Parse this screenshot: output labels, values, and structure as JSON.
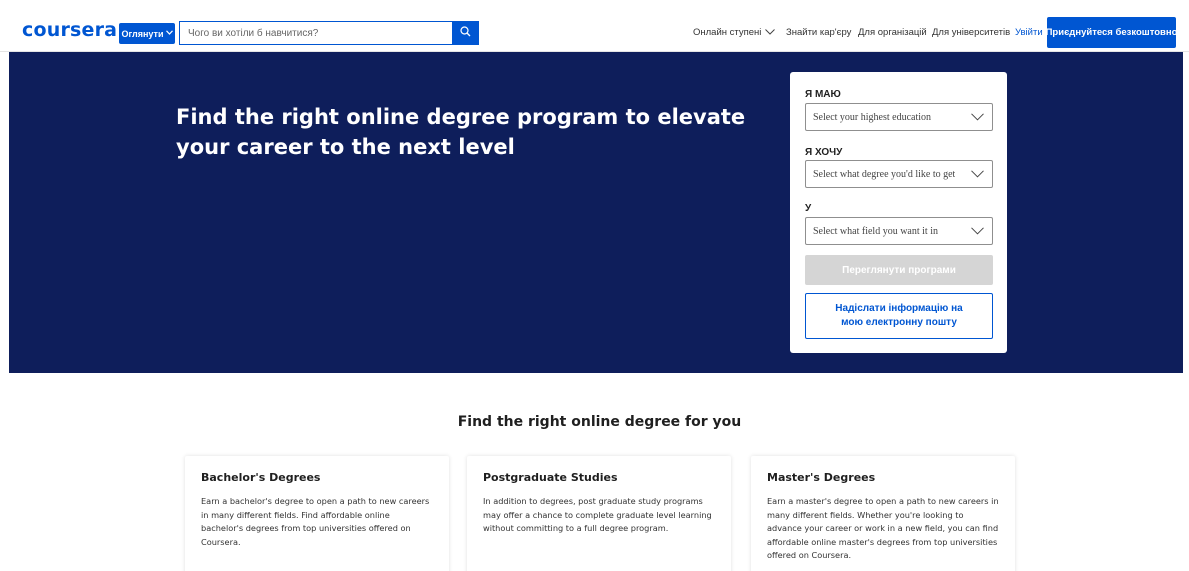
{
  "header": {
    "logo": "coursera",
    "explore_label": "Оглянути",
    "search_placeholder": "Чого ви хотіли б навчитися?",
    "nav": {
      "online_degrees": "Онлайн ступені",
      "find_career": "Знайти кар'єру",
      "for_organizations": "Для організацій",
      "for_universities": "Для університетів",
      "login": "Увійти"
    },
    "join_label": "Приєднуйтеся безкоштовно"
  },
  "hero": {
    "title": "Find the right online degree program to elevate your career to the next level",
    "form": {
      "have_label": "Я МАЮ",
      "have_select": "Select your highest education",
      "want_label": "Я ХОЧУ",
      "want_select": "Select what degree you'd like to get",
      "in_label": "У",
      "in_select": "Select what field you want it in",
      "view_programs_label": "Переглянути програми",
      "email_label": "Надіслати інформацію на мою електронну пошту"
    }
  },
  "degrees_section": {
    "title": "Find the right online degree for you",
    "cards": [
      {
        "title": "Bachelor's Degrees",
        "description": "Earn a bachelor's degree to open a path to new careers in many different fields. Find affordable online bachelor's degrees from top universities offered on Coursera."
      },
      {
        "title": "Postgraduate Studies",
        "description": "In addition to degrees, post graduate study programs may offer a chance to complete graduate level learning without committing to a full degree program."
      },
      {
        "title": "Master's Degrees",
        "description": "Earn a master's degree to open a path to new careers in many different fields. Whether you're looking to advance your career or work in a new field, you can find affordable online master's degrees from top universities offered on Coursera."
      }
    ]
  },
  "colors": {
    "brand_blue": "#0056d2",
    "hero_background": "#0e1e5b",
    "disabled_button": "#d5d5d5"
  },
  "icons": [
    "chevron-down-icon",
    "search-icon"
  ]
}
